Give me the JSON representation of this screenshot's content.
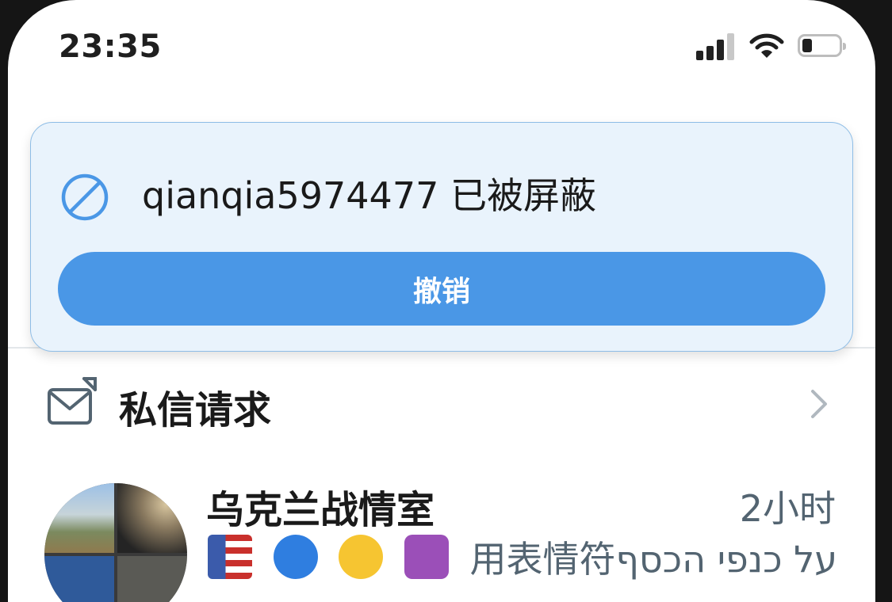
{
  "status_bar": {
    "time": "23:35"
  },
  "toast": {
    "message": "qianqia5974477 已被屏蔽",
    "undo_label": "撤销",
    "accent": "#4a97e6",
    "background": "#e9f3fc"
  },
  "message_requests": {
    "label": "私信请求"
  },
  "conversations": [
    {
      "name": "乌克兰战情室",
      "time": "2小时",
      "preview": "用表情符על כנפי הכסף"
    }
  ]
}
